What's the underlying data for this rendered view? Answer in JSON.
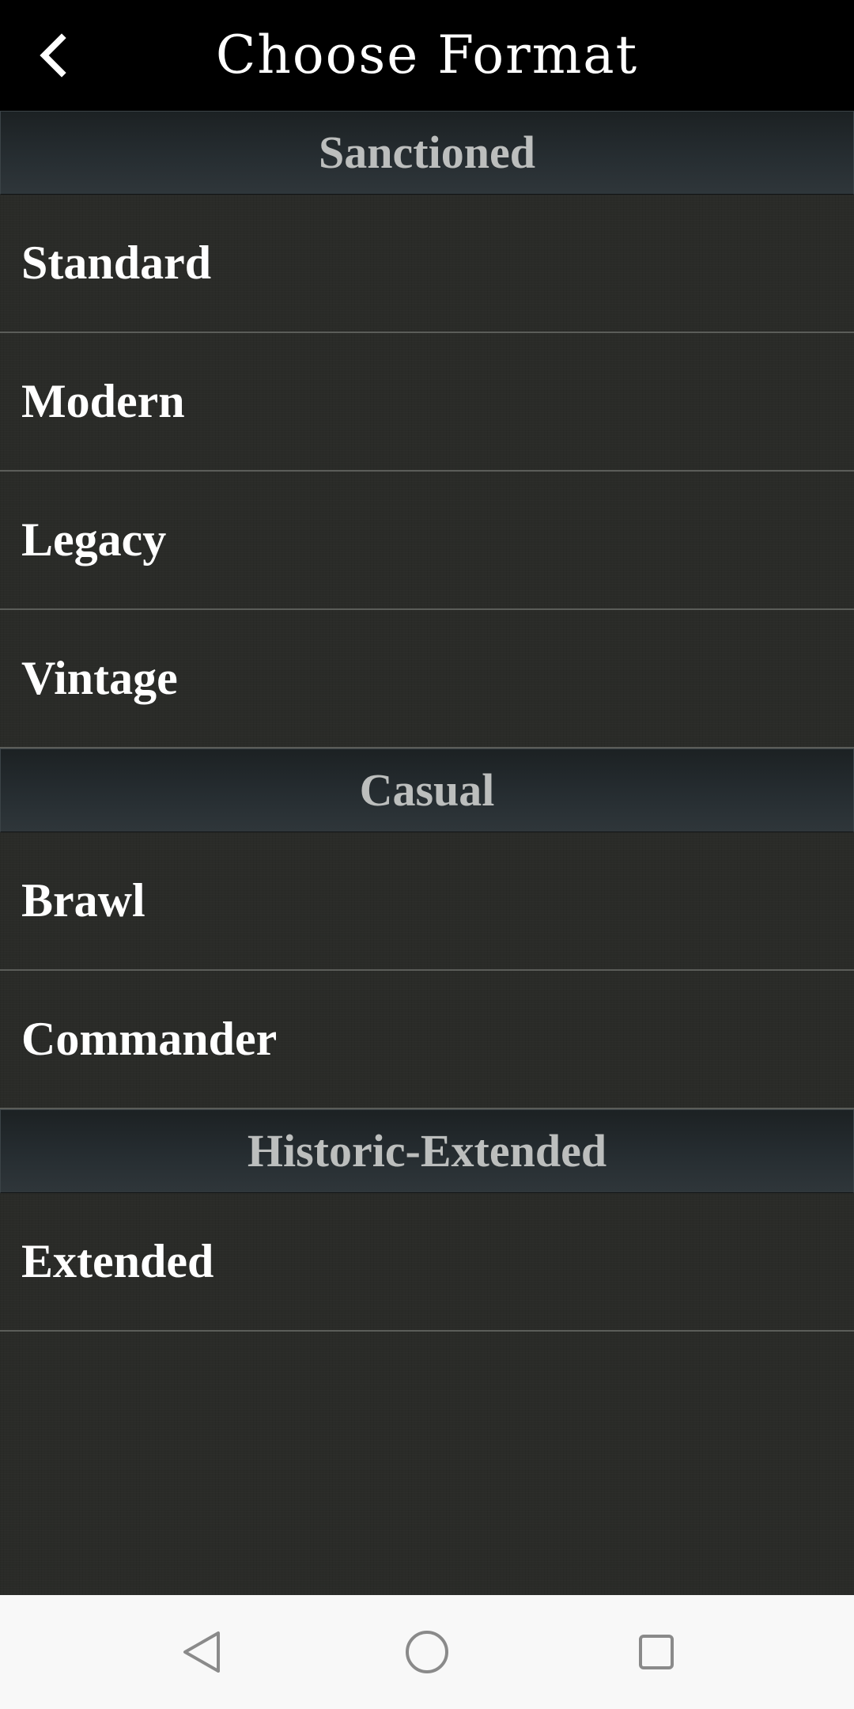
{
  "header": {
    "title": "Choose Format",
    "back_icon": "chevron-left-icon"
  },
  "sections": [
    {
      "title": "Sanctioned",
      "items": [
        "Standard",
        "Modern",
        "Legacy",
        "Vintage"
      ]
    },
    {
      "title": "Casual",
      "items": [
        "Brawl",
        "Commander"
      ]
    },
    {
      "title": "Historic-Extended",
      "items": [
        "Extended"
      ]
    }
  ],
  "system_nav": {
    "back_icon": "triangle-back-icon",
    "home_icon": "circle-home-icon",
    "recents_icon": "square-recents-icon"
  },
  "colors": {
    "topbar": "#000000",
    "background": "#2a2b28",
    "section_text": "#bcbebd",
    "item_text": "#ffffff",
    "navbar": "#f8f8f8"
  }
}
